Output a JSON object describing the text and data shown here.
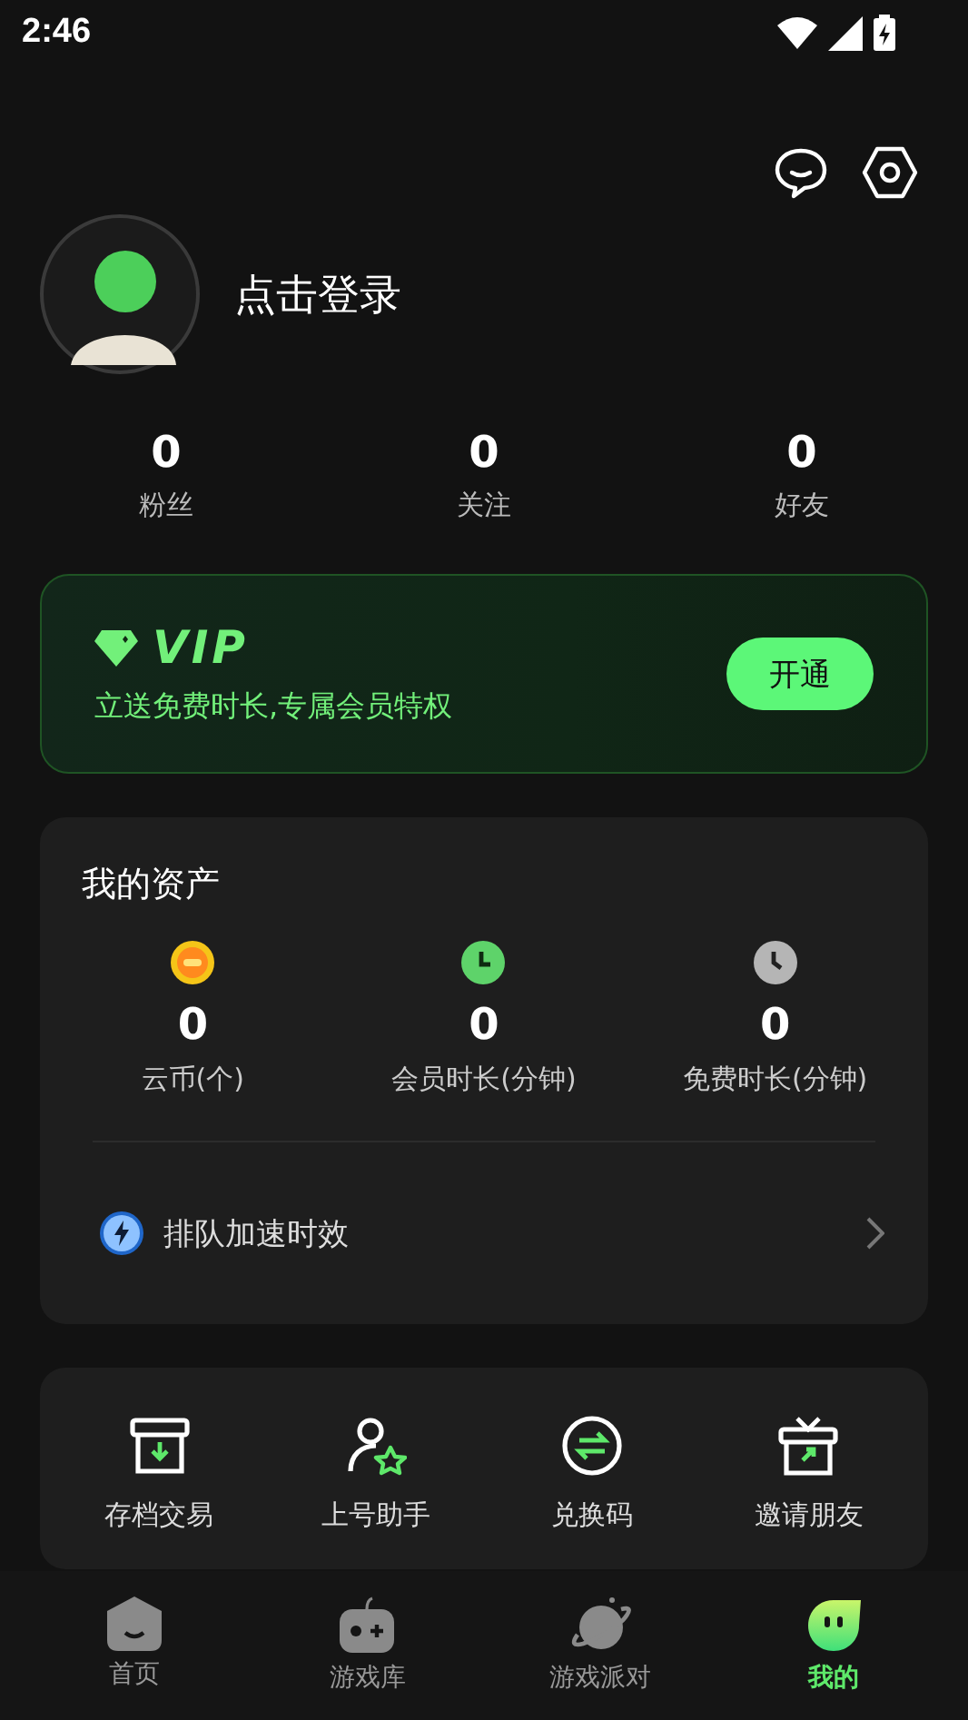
{
  "status_bar": {
    "time": "2:46"
  },
  "profile": {
    "login_label": "点击登录"
  },
  "stats": [
    {
      "value": "0",
      "label": "粉丝"
    },
    {
      "value": "0",
      "label": "关注"
    },
    {
      "value": "0",
      "label": "好友"
    }
  ],
  "vip": {
    "title": "VIP",
    "subtitle": "立送免费时长,专属会员特权",
    "button": "开通"
  },
  "assets": {
    "title": "我的资产",
    "items": [
      {
        "kind": "coin",
        "value": "0",
        "label": "云币(个)"
      },
      {
        "kind": "member",
        "value": "0",
        "label": "会员时长(分钟)"
      },
      {
        "kind": "free",
        "value": "0",
        "label": "免费时长(分钟)"
      }
    ],
    "queue_link": "排队加速时效"
  },
  "tools": [
    {
      "kind": "archive",
      "label": "存档交易"
    },
    {
      "kind": "helper",
      "label": "上号助手"
    },
    {
      "kind": "exchange",
      "label": "兑换码"
    },
    {
      "kind": "invite",
      "label": "邀请朋友"
    }
  ],
  "nav": [
    {
      "kind": "home",
      "label": "首页",
      "selected": false
    },
    {
      "kind": "library",
      "label": "游戏库",
      "selected": false
    },
    {
      "kind": "party",
      "label": "游戏派对",
      "selected": false
    },
    {
      "kind": "mine",
      "label": "我的",
      "selected": true
    }
  ]
}
